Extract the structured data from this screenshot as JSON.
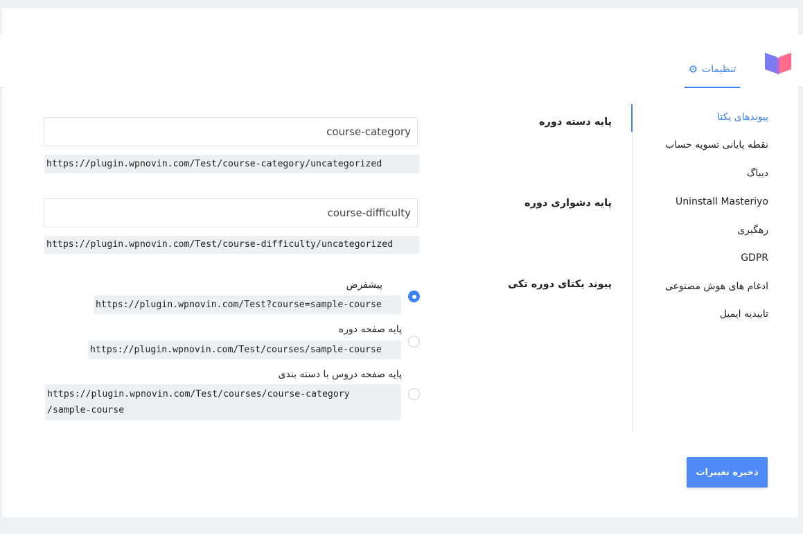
{
  "header": {
    "tab_label": "تنظیمات",
    "tab_icon": "gear-icon",
    "logo_icon": "book-logo-icon",
    "accent": "#3b82f6"
  },
  "sidebar": {
    "items": [
      {
        "label": "پیوندهای یکتا",
        "active": true
      },
      {
        "label": "نقطه پایانی تسویه حساب"
      },
      {
        "label": "دیباگ"
      },
      {
        "label": "Uninstall Masteriyo"
      },
      {
        "label": "رهگیری"
      },
      {
        "label": "GDPR"
      },
      {
        "label": "ادغام های هوش مصنوعی"
      },
      {
        "label": "تاییدیه ایمیل"
      }
    ]
  },
  "settings": {
    "category_base": {
      "label": "پایه دسته دوره",
      "value": "course-category",
      "preview": "https://plugin.wpnovin.com/Test/course-category/uncategorized"
    },
    "difficulty_base": {
      "label": "پایه دشواری دوره",
      "value": "course-difficulty",
      "preview": "https://plugin.wpnovin.com/Test/course-difficulty/uncategorized"
    },
    "single_course_permalink": {
      "label": "پیوند یکتای دوره تکی",
      "selected": 0,
      "options": [
        {
          "label": "پیشفرض",
          "url": "https://plugin.wpnovin.com/Test?course=sample-course"
        },
        {
          "label": "پایه صفحه دوره",
          "url": "https://plugin.wpnovin.com/Test/courses/sample-course"
        },
        {
          "label": "پایه صفحه دروس با دسته بندی",
          "url_line1": "https://plugin.wpnovin.com/Test/courses/course-category",
          "url_line2": "/sample-course"
        }
      ]
    }
  },
  "footer": {
    "save_label": "ذخیره تغییرات"
  }
}
